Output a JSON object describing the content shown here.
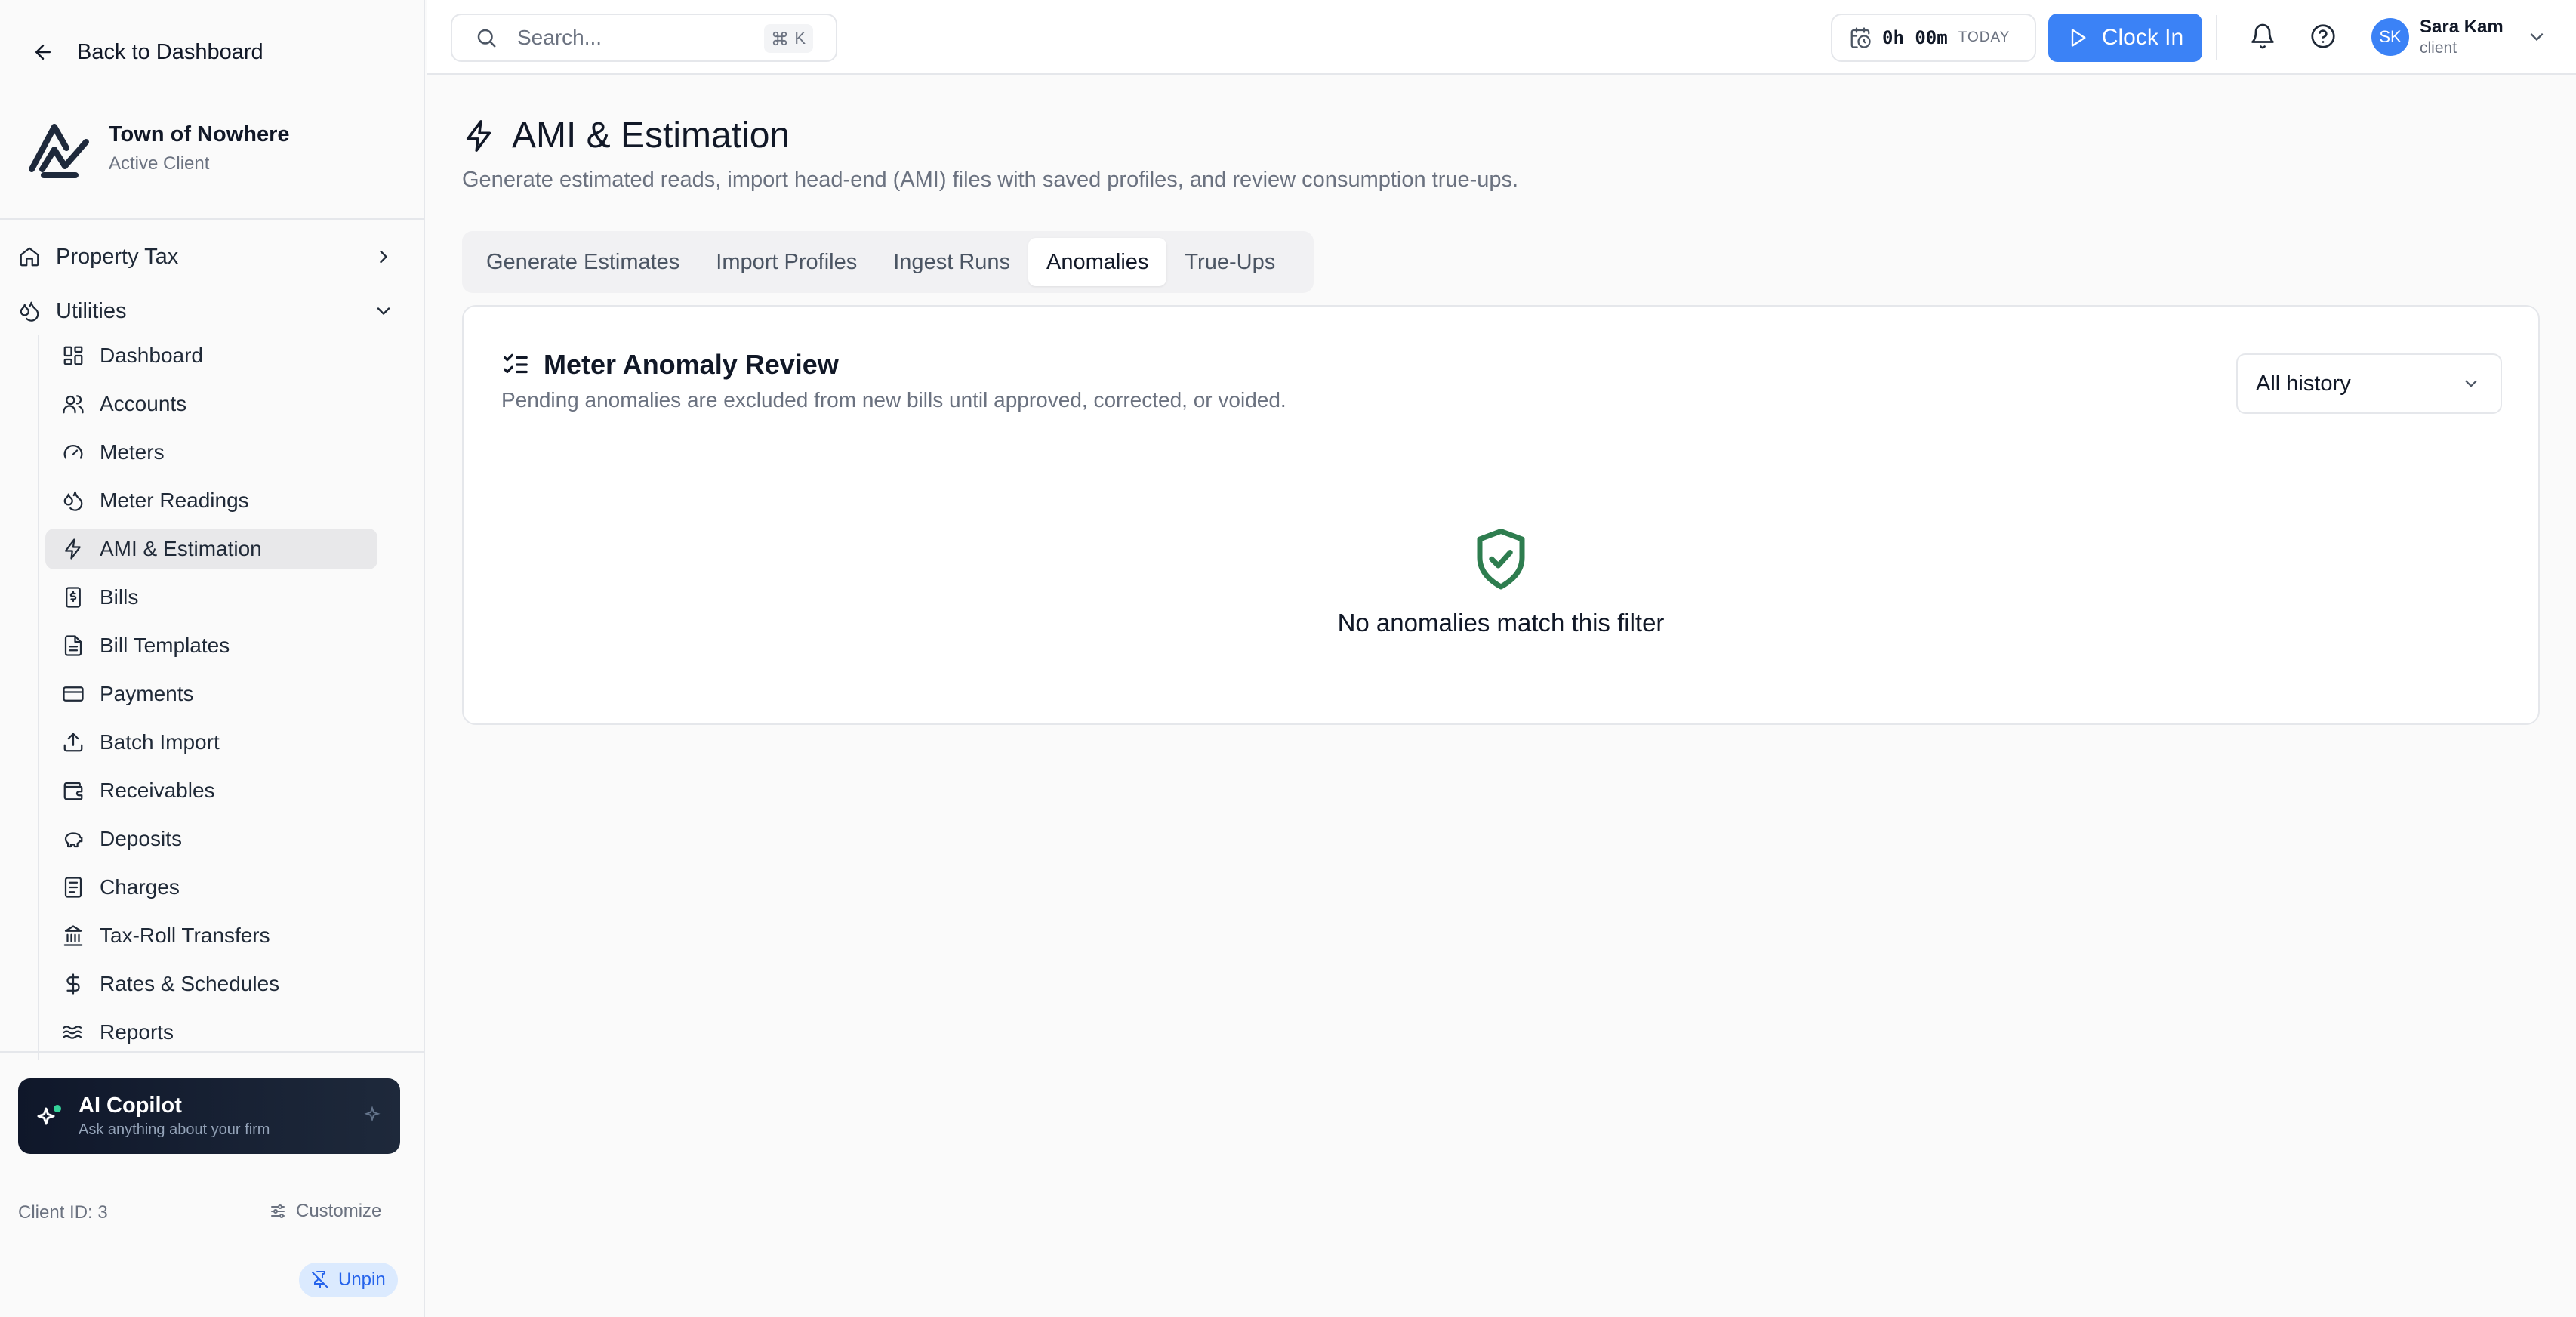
{
  "sidebar": {
    "back_label": "Back to Dashboard",
    "client_name": "Town of Nowhere",
    "client_status": "Active Client",
    "groups": [
      {
        "label": "Property Tax",
        "icon": "home-icon",
        "state": "collapsed"
      },
      {
        "label": "Utilities",
        "icon": "droplets-icon",
        "state": "expanded"
      }
    ],
    "items": [
      {
        "label": "Dashboard",
        "icon": "layout-grid-icon"
      },
      {
        "label": "Accounts",
        "icon": "users-icon"
      },
      {
        "label": "Meters",
        "icon": "gauge-icon"
      },
      {
        "label": "Meter Readings",
        "icon": "droplets-icon"
      },
      {
        "label": "AMI & Estimation",
        "icon": "zap-icon",
        "active": true
      },
      {
        "label": "Bills",
        "icon": "receipt-icon"
      },
      {
        "label": "Bill Templates",
        "icon": "file-text-icon"
      },
      {
        "label": "Payments",
        "icon": "credit-card-icon"
      },
      {
        "label": "Batch Import",
        "icon": "upload-icon"
      },
      {
        "label": "Receivables",
        "icon": "wallet-icon"
      },
      {
        "label": "Deposits",
        "icon": "piggy-bank-icon"
      },
      {
        "label": "Charges",
        "icon": "document-lines-icon"
      },
      {
        "label": "Tax-Roll Transfers",
        "icon": "landmark-icon"
      },
      {
        "label": "Rates & Schedules",
        "icon": "dollar-icon"
      },
      {
        "label": "Reports",
        "icon": "waves-icon"
      }
    ],
    "copilot": {
      "title": "AI Copilot",
      "subtitle": "Ask anything about your firm"
    },
    "client_id": "Client ID: 3",
    "customize_label": "Customize",
    "unpin_label": "Unpin"
  },
  "topbar": {
    "search_placeholder": "Search...",
    "shortcut_key": "K",
    "timer_value": "0h 00m",
    "timer_label": "TODAY",
    "clock_in_label": "Clock In",
    "user": {
      "initials": "SK",
      "name": "Sara Kam",
      "role": "client"
    }
  },
  "page": {
    "title": "AMI & Estimation",
    "description": "Generate estimated reads, import head-end (AMI) files with saved profiles, and review consumption true-ups.",
    "tabs": [
      {
        "label": "Generate Estimates"
      },
      {
        "label": "Import Profiles"
      },
      {
        "label": "Ingest Runs"
      },
      {
        "label": "Anomalies",
        "active": true
      },
      {
        "label": "True-Ups"
      }
    ]
  },
  "card": {
    "title": "Meter Anomaly Review",
    "description": "Pending anomalies are excluded from new bills until approved, corrected, or voided.",
    "filter_value": "All history",
    "empty_message": "No anomalies match this filter"
  },
  "colors": {
    "accent": "#3b82f6",
    "success": "#2e7d4f",
    "sidebar_active": "#e8e8ea"
  }
}
